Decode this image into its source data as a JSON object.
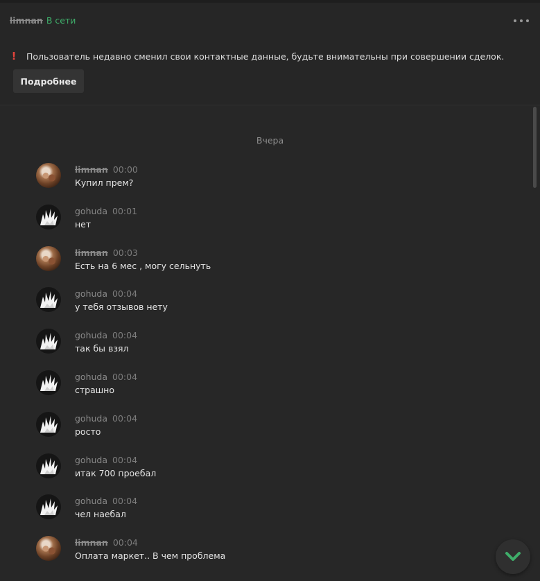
{
  "header": {
    "username": "limnan",
    "status": "В сети",
    "status_color": "#3fae6a",
    "menu_icon": "more-horizontal-icon"
  },
  "warning": {
    "icon": "exclamation-icon",
    "text": "Пользователь недавно сменил свои контактные данные, будьте внимательны при совершении сделок.",
    "button_label": "Подробнее"
  },
  "chat": {
    "date_separator": "Вчера",
    "messages": [
      {
        "author": "limnan",
        "time": "00:00",
        "text": "Купил прем?"
      },
      {
        "author": "gohuda",
        "time": "00:01",
        "text": "нет"
      },
      {
        "author": "limnan",
        "time": "00:03",
        "text": "Есть на 6 мес , могу сельнуть"
      },
      {
        "author": "gohuda",
        "time": "00:04",
        "text": "у тебя отзывов нету"
      },
      {
        "author": "gohuda",
        "time": "00:04",
        "text": "так бы взял"
      },
      {
        "author": "gohuda",
        "time": "00:04",
        "text": "страшно"
      },
      {
        "author": "gohuda",
        "time": "00:04",
        "text": "росто"
      },
      {
        "author": "gohuda",
        "time": "00:04",
        "text": "итак 700 проебал"
      },
      {
        "author": "gohuda",
        "time": "00:04",
        "text": "чел наебал"
      },
      {
        "author": "limnan",
        "time": "00:04",
        "text": "Оплата маркет.. В чем проблема"
      }
    ]
  },
  "scroll_down_icon": "chevron-down-icon",
  "accent_color": "#3fae6a"
}
